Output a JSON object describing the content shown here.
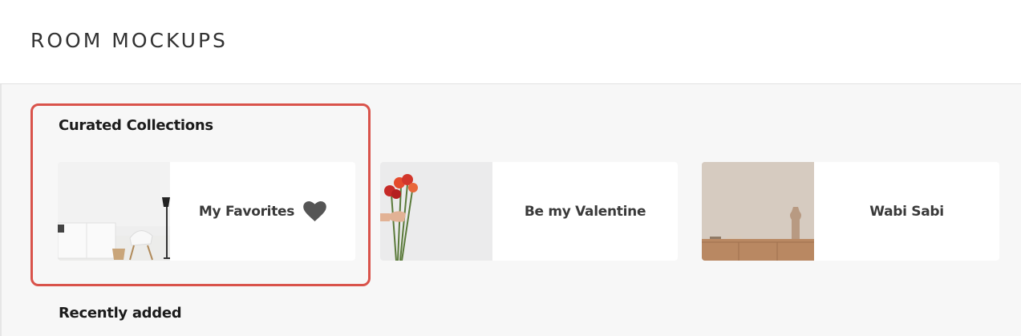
{
  "header": {
    "title": "ROOM MOCKUPS"
  },
  "sections": {
    "curated_title": "Curated Collections",
    "recent_title": "Recently added"
  },
  "collections": [
    {
      "label": "My Favorites",
      "icon": "heart-icon",
      "thumbnail": "white living room with sideboard, chair and floor lamp"
    },
    {
      "label": "Be my Valentine",
      "thumbnail": "hand holding red roses against white wall"
    },
    {
      "label": "Wabi Sabi",
      "thumbnail": "wooden sideboard with vase against beige wall"
    }
  ],
  "colors": {
    "highlight": "#d9534b",
    "background": "#f7f7f7",
    "card": "#ffffff",
    "text": "#3a3a3a"
  }
}
